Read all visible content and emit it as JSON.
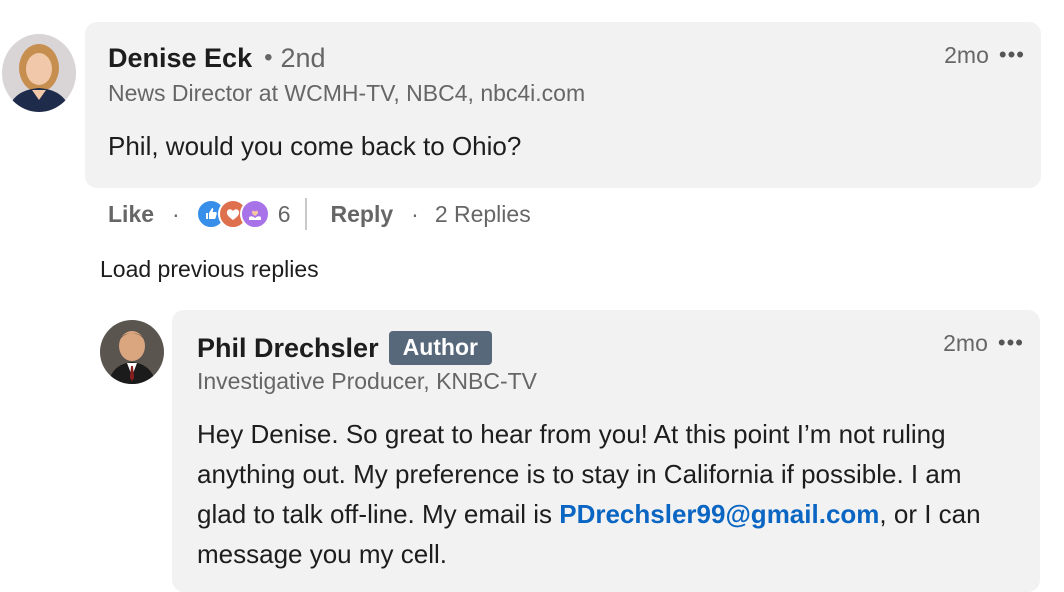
{
  "comment": {
    "author": "Denise Eck",
    "separator": "•",
    "degree": "2nd",
    "headline": "News Director at WCMH-TV, NBC4, nbc4i.com",
    "time": "2mo",
    "more_icon": "more-dots-icon",
    "text": "Phil, would you come back to Ohio?"
  },
  "actions": {
    "like_label": "Like",
    "separator": "·",
    "reaction_icons": [
      "like-reaction-icon",
      "love-reaction-icon",
      "support-reaction-icon"
    ],
    "reaction_count": "6",
    "reply_label": "Reply",
    "replies_label": "2 Replies"
  },
  "load_previous_label": "Load previous replies",
  "reply": {
    "author": "Phil Drechsler",
    "badge": "Author",
    "headline": "Investigative Producer, KNBC-TV",
    "time": "2mo",
    "more_icon": "more-dots-icon",
    "text_before_email": "Hey Denise. So great to hear from you! At this point I’m not ruling anything out. My preference is to stay in California if possible. I am glad to talk off-line. My email is ",
    "email": "PDrechsler99@gmail.com",
    "text_after_email": ", or I can message you my cell."
  },
  "colors": {
    "bubble_bg": "#f2f2f2",
    "badge_bg": "#56687a",
    "link": "#0a66c2",
    "secondary_text": "#666666"
  }
}
